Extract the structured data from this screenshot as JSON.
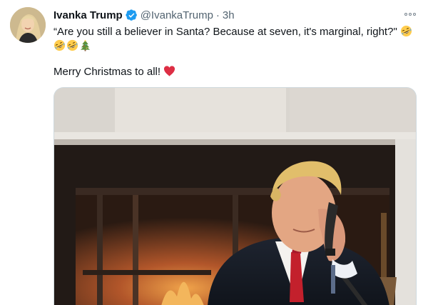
{
  "tweet": {
    "display_name": "Ivanka Trump",
    "handle": "@IvankaTrump",
    "separator": "·",
    "time": "3h",
    "text_line1": "“Are you still a believer in Santa? Because at seven, it's marginal, right?\"",
    "text_line3": "Merry Christmas to all!",
    "icons": {
      "avatar": "profile-avatar",
      "verified": "verified-badge-icon",
      "more": "more-options-icon",
      "emoji_laugh": "rolling-on-floor-laughing-emoji",
      "emoji_tree": "christmas-tree-emoji",
      "emoji_heart": "red-heart-emoji"
    }
  },
  "colors": {
    "name": "#0f1419",
    "secondary": "#536471",
    "verified": "#1d9bf0",
    "heart": "#e0245e"
  }
}
